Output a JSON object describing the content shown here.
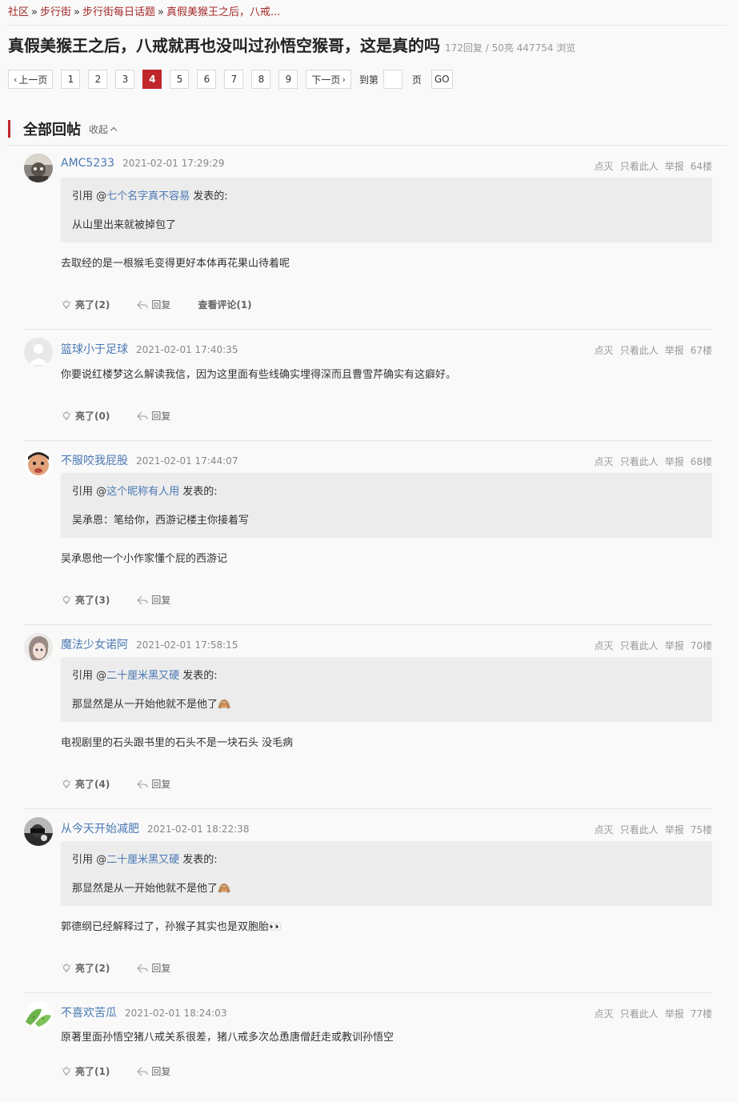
{
  "breadcrumb": {
    "items": [
      "社区",
      "步行街",
      "步行街每日话题",
      "真假美猴王之后，八戒..."
    ],
    "sep": "»"
  },
  "thread": {
    "title": "真假美猴王之后，八戒就再也没叫过孙悟空猴哥，这是真的吗",
    "stats": "172回复 / 50亮 447754 浏览"
  },
  "pager": {
    "prev": "上一页",
    "pages": [
      "1",
      "2",
      "3",
      "4",
      "5",
      "6",
      "7",
      "8",
      "9"
    ],
    "active_page": "4",
    "next": "下一页",
    "goto_label": "到第",
    "page_unit": "页",
    "go": "GO"
  },
  "section": {
    "title": "全部回帖",
    "collapse": "收起"
  },
  "post_actions": {
    "hide": "点灭",
    "only_author": "只看此人",
    "report": "举报",
    "reply": "回复",
    "view_comments": "查看评论(1)"
  },
  "posts": [
    {
      "username": "AMC5233",
      "time": "2021-02-01 17:29:29",
      "floor": "64楼",
      "quote_prefix": "引用 @",
      "quote_user": "七个名字真不容易",
      "quote_suffix": " 发表的:",
      "quote_text": "从山里出来就被掉包了",
      "content": "去取经的是一根猴毛变得更好本体再花果山待着呢",
      "light": "亮了(2)"
    },
    {
      "username": "篮球小于足球",
      "time": "2021-02-01 17:40:35",
      "floor": "67楼",
      "content": "你要说红楼梦这么解读我信，因为这里面有些线确实埋得深而且曹雪芹确实有这癖好。",
      "light": "亮了(0)"
    },
    {
      "username": "不服咬我屁股",
      "time": "2021-02-01 17:44:07",
      "floor": "68楼",
      "quote_prefix": "引用 @",
      "quote_user": "这个昵称有人用",
      "quote_suffix": " 发表的:",
      "quote_text": "吴承恩：笔给你，西游记楼主你接着写",
      "content": "吴承恩他一个小作家懂个屁的西游记",
      "light": "亮了(3)"
    },
    {
      "username": "魔法少女诺阿",
      "time": "2021-02-01 17:58:15",
      "floor": "70楼",
      "quote_prefix": "引用 @",
      "quote_user": "二十厘米黑又硬",
      "quote_suffix": " 发表的:",
      "quote_text": "那显然是从一开始他就不是他了🙈",
      "content": "电视剧里的石头跟书里的石头不是一块石头 没毛病",
      "light": "亮了(4)"
    },
    {
      "username": "从今天开始减肥",
      "time": "2021-02-01 18:22:38",
      "floor": "75楼",
      "quote_prefix": "引用 @",
      "quote_user": "二十厘米黑又硬",
      "quote_suffix": " 发表的:",
      "quote_text": "那显然是从一开始他就不是他了🙈",
      "content": "郭德纲已经解释过了，孙猴子其实也是双胞胎👀",
      "light": "亮了(2)"
    },
    {
      "username": "不喜欢苦瓜",
      "time": "2021-02-01 18:24:03",
      "floor": "77楼",
      "content": "原著里面孙悟空猪八戒关系很差，猪八戒多次怂恿唐僧赶走或教训孙悟空",
      "light": "亮了(1)"
    }
  ],
  "colors": {
    "accent": "#c0272d",
    "link": "#4a79b3",
    "breadcrumb_link": "#a52a2a",
    "quote_bg": "#ececec"
  }
}
